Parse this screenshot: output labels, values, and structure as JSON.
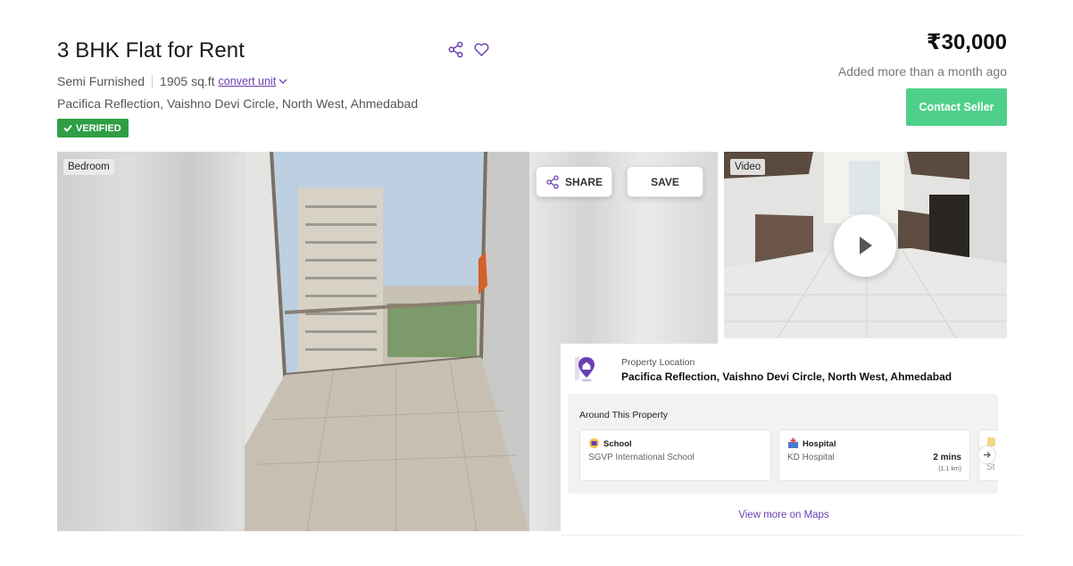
{
  "listing": {
    "title": "3 BHK Flat for Rent",
    "furnishing": "Semi Furnished",
    "area": "1905 sq.ft",
    "convert_unit": "convert unit",
    "address": "Pacifica Reflection, Vaishno Devi Circle, North West, Ahmedabad",
    "verified": "VERIFIED",
    "price": "₹30,000",
    "added": "Added more than a month ago",
    "contact_label": "Contact Seller"
  },
  "gallery": {
    "main_tag": "Bedroom",
    "share_label": "SHARE",
    "save_label": "SAVE",
    "video_tag": "Video"
  },
  "location": {
    "label": "Property Location",
    "value": "Pacifica Reflection, Vaishno Devi Circle, North West, Ahmedabad",
    "around_title": "Around This Property",
    "places": [
      {
        "type": "School",
        "name": "SGVP International School",
        "time": "",
        "distance": ""
      },
      {
        "type": "Hospital",
        "name": "KD Hospital",
        "time": "2 mins",
        "distance": "(1.1 km)"
      }
    ],
    "partial_text": "St",
    "view_more": "View more on Maps"
  },
  "colors": {
    "accent": "#6b3fb3",
    "contact_button": "#4fd08a",
    "verified_badge": "#2f9e44"
  },
  "icons": [
    "share-icon",
    "heart-icon",
    "check-icon",
    "chevron-down-icon",
    "play-icon",
    "location-pin-icon",
    "school-icon",
    "hospital-icon",
    "chevron-right-icon"
  ]
}
